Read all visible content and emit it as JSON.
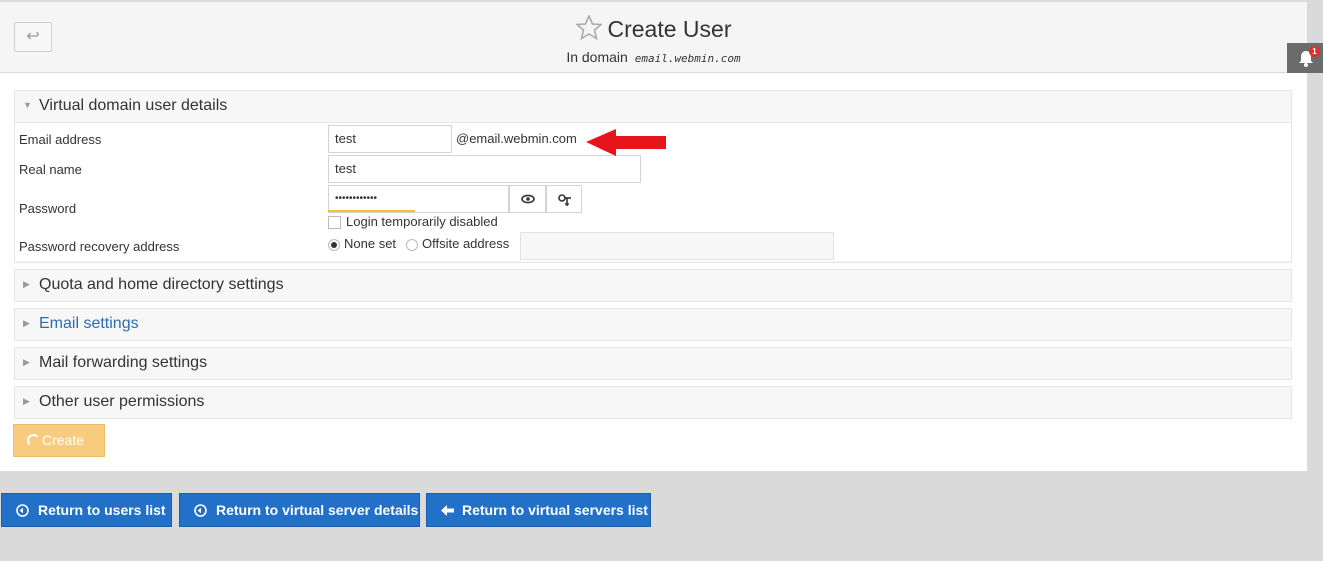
{
  "header": {
    "back_icon": "return-arrow-icon",
    "title": "Create User",
    "subtitle_prefix": "In domain",
    "domain": "email.webmin.com",
    "favorite_icon": "star-icon"
  },
  "notifications": {
    "icon": "bell-icon",
    "count": "1"
  },
  "sections": {
    "details": {
      "title": "Virtual domain user details",
      "fields": {
        "email_label": "Email address",
        "email_value": "test",
        "email_suffix": "@email.webmin.com",
        "realname_label": "Real name",
        "realname_value": "test",
        "password_label": "Password",
        "password_value": "••••••••••••",
        "show_password_icon": "eye-icon",
        "generate_password_icon": "key-icon",
        "login_disabled_label": "Login temporarily disabled",
        "recovery_label": "Password recovery address",
        "recovery_none": "None set",
        "recovery_offsite": "Offsite address"
      }
    },
    "quota": {
      "title": "Quota and home directory settings"
    },
    "email": {
      "title": "Email settings"
    },
    "forwarding": {
      "title": "Mail forwarding settings"
    },
    "permissions": {
      "title": "Other user permissions"
    }
  },
  "create_button": {
    "label": "Create"
  },
  "bottom_buttons": {
    "users_list": "Return to users list",
    "server_details": "Return to virtual server details",
    "servers_list": "Return to virtual servers list"
  },
  "colors": {
    "accent_blue": "#2270c8",
    "create_orange": "#f7cc7f",
    "annotation_red": "#e8141b"
  }
}
